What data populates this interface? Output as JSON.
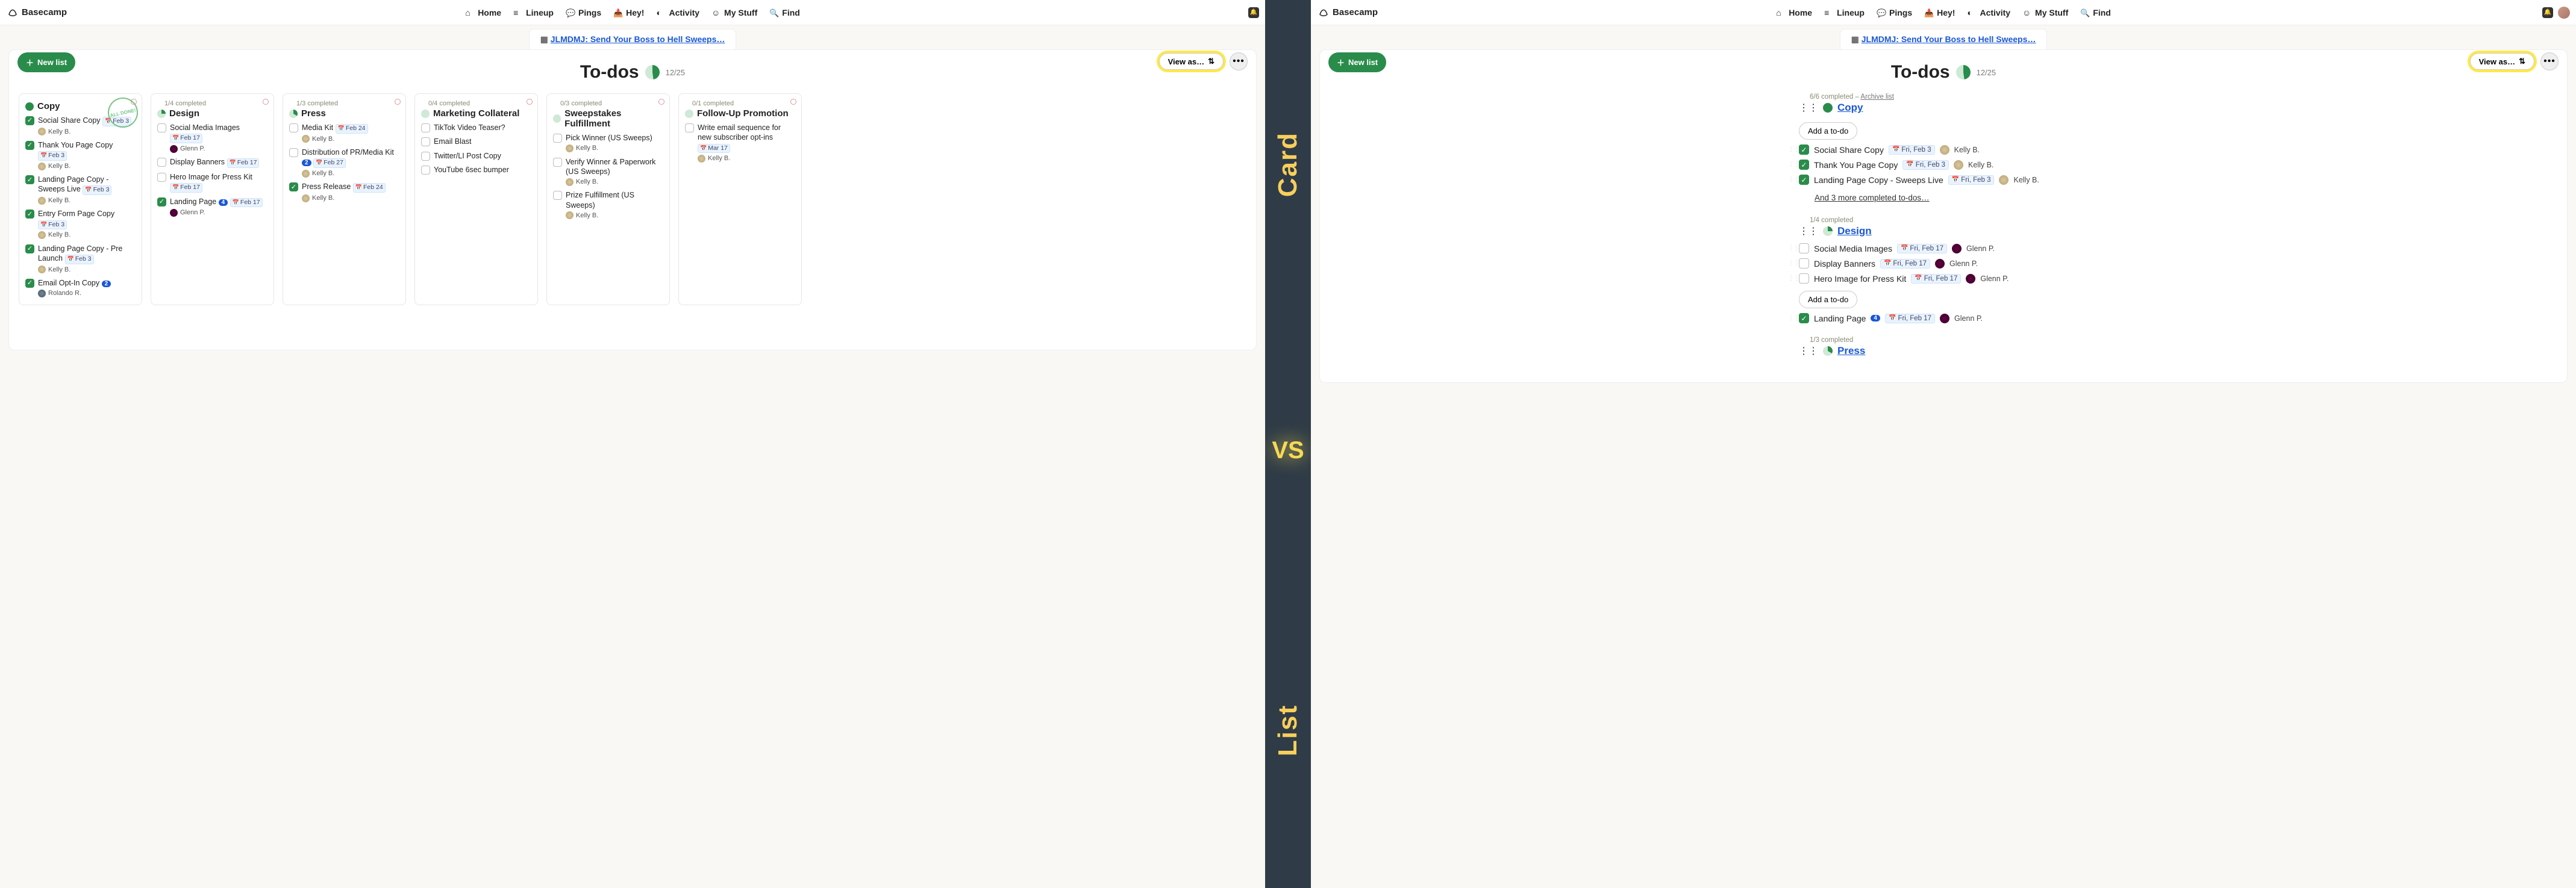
{
  "divider": {
    "top": "Card",
    "mid": "VS",
    "bottom": "List"
  },
  "nav": {
    "brand": "Basecamp",
    "items": [
      {
        "label": "Home",
        "icon": "home-icon"
      },
      {
        "label": "Lineup",
        "icon": "lineup-icon"
      },
      {
        "label": "Pings",
        "icon": "pings-icon"
      },
      {
        "label": "Hey!",
        "icon": "hey-icon"
      },
      {
        "label": "Activity",
        "icon": "activity-icon"
      },
      {
        "label": "My Stuff",
        "icon": "mystuff-icon"
      },
      {
        "label": "Find",
        "icon": "find-icon"
      }
    ]
  },
  "breadcrumb": {
    "prefix": "",
    "link": "JLMDMJ: Send Your Boss to Hell Sweeps…"
  },
  "sheet": {
    "new_list": "New list",
    "title": "To-dos",
    "counter": "12/25",
    "view_as": "View as…",
    "dots": "•••"
  },
  "card_lists": [
    {
      "name": "Copy",
      "completed_note": "",
      "pie": "full",
      "stamp": "ALL DONE!",
      "todos": [
        {
          "done": true,
          "text": "Social Share Copy",
          "date": "Feb 3",
          "people": [
            {
              "name": "Kelly B.",
              "cls": "kb"
            }
          ]
        },
        {
          "done": true,
          "text": "Thank You Page Copy",
          "date": "Feb 3",
          "people": [
            {
              "name": "Kelly B.",
              "cls": "kb"
            }
          ]
        },
        {
          "done": true,
          "text": "Landing Page Copy - Sweeps Live",
          "date": "Feb 3",
          "people": [
            {
              "name": "Kelly B.",
              "cls": "kb"
            }
          ]
        },
        {
          "done": true,
          "text": "Entry Form Page Copy",
          "date": "Feb 3",
          "people": [
            {
              "name": "Kelly B.",
              "cls": "kb"
            }
          ]
        },
        {
          "done": true,
          "text": "Landing Page Copy - Pre Launch",
          "date": "Feb 3",
          "people": [
            {
              "name": "Kelly B.",
              "cls": "kb"
            }
          ]
        },
        {
          "done": true,
          "text": "Email Opt-In Copy",
          "badge": "2",
          "people": [
            {
              "name": "Rolando R.",
              "cls": "rr"
            }
          ]
        }
      ]
    },
    {
      "name": "Design",
      "completed_note": "1/4 completed",
      "pie": "p25",
      "todos": [
        {
          "done": false,
          "text": "Social Media Images",
          "date": "Feb 17",
          "people": [
            {
              "name": "Glenn P.",
              "cls": "gp"
            }
          ]
        },
        {
          "done": false,
          "text": "Display Banners",
          "date": "Feb 17"
        },
        {
          "done": false,
          "text": "Hero Image for Press Kit",
          "date": "Feb 17"
        },
        {
          "done": true,
          "text": "Landing Page",
          "badge": "4",
          "date": "Feb 17",
          "people": [
            {
              "name": "Glenn P.",
              "cls": "gp"
            }
          ]
        }
      ]
    },
    {
      "name": "Press",
      "completed_note": "1/3 completed",
      "pie": "p33",
      "todos": [
        {
          "done": false,
          "text": "Media Kit",
          "date": "Feb 24",
          "people": [
            {
              "name": "Kelly B.",
              "cls": "kb"
            }
          ]
        },
        {
          "done": false,
          "text": "Distribution of PR/Media Kit",
          "badge": "2",
          "date": "Feb 27",
          "people": [
            {
              "name": "Kelly B.",
              "cls": "kb"
            }
          ]
        },
        {
          "done": true,
          "text": "Press Release",
          "date": "Feb 24",
          "people": [
            {
              "name": "Kelly B.",
              "cls": "kb"
            }
          ]
        }
      ]
    },
    {
      "name": "Marketing Collateral",
      "completed_note": "0/4 completed",
      "pie": "p0",
      "todos": [
        {
          "done": false,
          "text": "TikTok Video Teaser?"
        },
        {
          "done": false,
          "text": "Email Blast"
        },
        {
          "done": false,
          "text": "Twitter/LI Post Copy"
        },
        {
          "done": false,
          "text": "YouTube 6sec bumper"
        }
      ]
    },
    {
      "name": "Sweepstakes Fulfillment",
      "completed_note": "0/3 completed",
      "pie": "p0",
      "todos": [
        {
          "done": false,
          "text": "Pick Winner (US Sweeps)",
          "people": [
            {
              "name": "Kelly B.",
              "cls": "kb"
            }
          ]
        },
        {
          "done": false,
          "text": "Verify Winner & Paperwork (US Sweeps)",
          "people": [
            {
              "name": "Kelly B.",
              "cls": "kb"
            }
          ]
        },
        {
          "done": false,
          "text": "Prize Fulfillment (US Sweeps)",
          "people": [
            {
              "name": "Kelly B.",
              "cls": "kb"
            }
          ]
        }
      ]
    },
    {
      "name": "Follow-Up Promotion",
      "completed_note": "0/1 completed",
      "pie": "p0",
      "todos": [
        {
          "done": false,
          "text": "Write email sequence for new subscriber opt-ins",
          "date": "Mar 17",
          "people": [
            {
              "name": "Kelly B.",
              "cls": "kb"
            }
          ]
        }
      ]
    }
  ],
  "list_view": {
    "add_label": "Add a to-do",
    "more_copy": "And 3 more completed to-dos…",
    "groups": [
      {
        "status_html": "6/6 completed – ",
        "archive": "Archive list",
        "name": "Copy",
        "pie": "full",
        "add_position": "top",
        "rows": [
          {
            "done": true,
            "text": "Social Share Copy",
            "date": "Fri, Feb 3",
            "person": {
              "name": "Kelly B.",
              "cls": "kb"
            }
          },
          {
            "done": true,
            "text": "Thank You Page Copy",
            "date": "Fri, Feb 3",
            "person": {
              "name": "Kelly B.",
              "cls": "kb"
            }
          },
          {
            "done": true,
            "text": "Landing Page Copy - Sweeps Live",
            "date": "Fri, Feb 3",
            "person": {
              "name": "Kelly B.",
              "cls": "kb"
            }
          }
        ],
        "more": true
      },
      {
        "status_html": "1/4 completed",
        "name": "Design",
        "pie": "p25",
        "add_position": "bottom",
        "rows": [
          {
            "done": false,
            "text": "Social Media Images",
            "date": "Fri, Feb 17",
            "person": {
              "name": "Glenn P.",
              "cls": "gp"
            }
          },
          {
            "done": false,
            "text": "Display Banners",
            "date": "Fri, Feb 17",
            "person": {
              "name": "Glenn P.",
              "cls": "gp"
            }
          },
          {
            "done": false,
            "text": "Hero Image for Press Kit",
            "date": "Fri, Feb 17",
            "person": {
              "name": "Glenn P.",
              "cls": "gp"
            }
          }
        ],
        "after_rows": [
          {
            "done": true,
            "text": "Landing Page",
            "badge": "4",
            "date": "Fri, Feb 17",
            "person": {
              "name": "Glenn P.",
              "cls": "gp"
            }
          }
        ]
      },
      {
        "status_html": "1/3 completed",
        "name": "Press",
        "pie": "p33"
      }
    ]
  }
}
